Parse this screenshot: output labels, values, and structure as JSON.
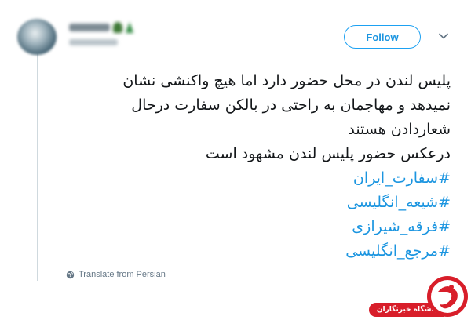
{
  "tweet": {
    "follow_label": "Follow",
    "lines": [
      "پلیس لندن در محل حضور دارد اما هیچ واکنشی نشان",
      "نمیدهد و مهاجمان به راحتی در بالکن سفارت درحال",
      "شعاردادن هستند",
      "درعکس حضور پلیس لندن مشهود است"
    ],
    "hashtags": [
      "#سفارت_ایران",
      "#شیعه_انگلیسی",
      "#فرقه_شیرازی",
      "#مرجع_انگلیسی"
    ],
    "translate_label": "Translate from Persian"
  },
  "watermark": {
    "label": "باشگاه خبرنگاران"
  },
  "colors": {
    "link": "#1b95e0",
    "text": "#14171a",
    "muted": "#657786",
    "follow_border": "#1da1f2",
    "watermark_red": "#d81e2a"
  },
  "icons": {
    "chevron": "chevron-down-icon",
    "globe": "globe-icon",
    "logo": "news-agency-logo"
  }
}
